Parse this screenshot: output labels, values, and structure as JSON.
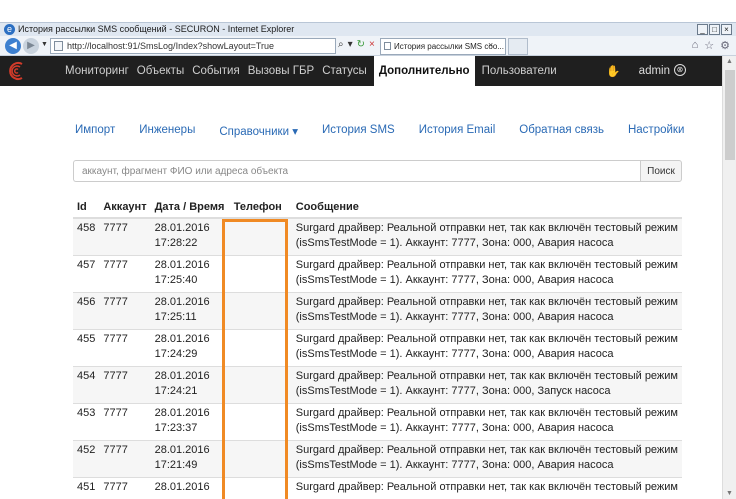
{
  "browser": {
    "window_title": "История рассылки SMS сообщений - SECURON - Internet Explorer",
    "address": "http://localhost:91/SmsLog/Index?showLayout=True",
    "tab_title": "История рассылки SMS соо...",
    "window_buttons": [
      "_",
      "□",
      "×"
    ]
  },
  "navbar": {
    "items": [
      {
        "label": "Мониторинг"
      },
      {
        "label": "Объекты"
      },
      {
        "label": "События"
      },
      {
        "label": "Вызовы ГБР"
      },
      {
        "label": "Статусы"
      },
      {
        "label": "Дополнительно",
        "active": true
      },
      {
        "label": "Пользователи"
      }
    ],
    "user": "admin"
  },
  "subnav": {
    "items": [
      "Импорт",
      "Инженеры",
      "Справочники ▾",
      "История SMS",
      "История Email",
      "Обратная связь",
      "Настройки"
    ]
  },
  "search": {
    "placeholder": "аккаунт, фрагмент ФИО или адреса объекта",
    "button": "Поиск"
  },
  "table": {
    "headers": [
      "Id",
      "Аккаунт",
      "Дата / Время",
      "Телефон",
      "Сообщение"
    ],
    "rows": [
      {
        "id": "458",
        "account": "7777",
        "date": "28.01.2016",
        "time": "17:28:22",
        "phone": "",
        "msg1": "Surgard драйвер: Реальной отправки нет, так как включён тестовый режим",
        "msg2": "(isSmsTestMode = 1). Аккаунт: 7777, Зона: 000, Авария насоса"
      },
      {
        "id": "457",
        "account": "7777",
        "date": "28.01.2016",
        "time": "17:25:40",
        "phone": "",
        "msg1": "Surgard драйвер: Реальной отправки нет, так как включён тестовый режим",
        "msg2": "(isSmsTestMode = 1). Аккаунт: 7777, Зона: 000, Авария насоса"
      },
      {
        "id": "456",
        "account": "7777",
        "date": "28.01.2016",
        "time": "17:25:11",
        "phone": "",
        "msg1": "Surgard драйвер: Реальной отправки нет, так как включён тестовый режим",
        "msg2": "(isSmsTestMode = 1). Аккаунт: 7777, Зона: 000, Авария насоса"
      },
      {
        "id": "455",
        "account": "7777",
        "date": "28.01.2016",
        "time": "17:24:29",
        "phone": "",
        "msg1": "Surgard драйвер: Реальной отправки нет, так как включён тестовый режим",
        "msg2": "(isSmsTestMode = 1). Аккаунт: 7777, Зона: 000, Авария насоса"
      },
      {
        "id": "454",
        "account": "7777",
        "date": "28.01.2016",
        "time": "17:24:21",
        "phone": "",
        "msg1": "Surgard драйвер: Реальной отправки нет, так как включён тестовый режим",
        "msg2": "(isSmsTestMode = 1). Аккаунт: 7777, Зона: 000, Запуск насоса"
      },
      {
        "id": "453",
        "account": "7777",
        "date": "28.01.2016",
        "time": "17:23:37",
        "phone": "",
        "msg1": "Surgard драйвер: Реальной отправки нет, так как включён тестовый режим",
        "msg2": "(isSmsTestMode = 1). Аккаунт: 7777, Зона: 000, Авария насоса"
      },
      {
        "id": "452",
        "account": "7777",
        "date": "28.01.2016",
        "time": "17:21:49",
        "phone": "",
        "msg1": "Surgard драйвер: Реальной отправки нет, так как включён тестовый режим",
        "msg2": "(isSmsTestMode = 1). Аккаунт: 7777, Зона: 000, Авария насоса"
      },
      {
        "id": "451",
        "account": "7777",
        "date": "28.01.2016",
        "time": "",
        "phone": "",
        "msg1": "Surgard драйвер: Реальной отправки нет, так как включён тестовый режим",
        "msg2": ""
      }
    ]
  },
  "colors": {
    "navbar_bg": "#1f1f1f",
    "link": "#2a6ab5",
    "redaction_outline": "#f08a24",
    "logo": "#d23b2a"
  }
}
